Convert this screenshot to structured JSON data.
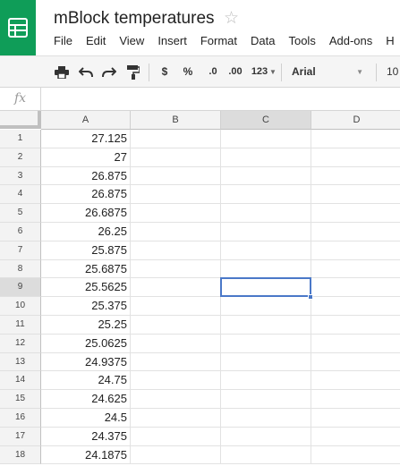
{
  "doc": {
    "title": "mBlock temperatures",
    "star": "☆"
  },
  "menu": [
    "File",
    "Edit",
    "View",
    "Insert",
    "Format",
    "Data",
    "Tools",
    "Add-ons",
    "H"
  ],
  "toolbar": {
    "print_icon": "print-icon",
    "undo_icon": "undo-icon",
    "redo_icon": "redo-icon",
    "paint_icon": "paint-format-icon",
    "currency": "$",
    "percent": "%",
    "decrease_decimal": ".0",
    "increase_decimal": ".00",
    "more_formats": "123",
    "font": "Arial",
    "font_size": "10"
  },
  "formula_bar": {
    "fx": "fx",
    "value": ""
  },
  "grid": {
    "columns": [
      "A",
      "B",
      "C",
      "D"
    ],
    "selected_column": "C",
    "selected_row": "9",
    "rows": [
      {
        "num": "1",
        "a": "27.125"
      },
      {
        "num": "2",
        "a": "27"
      },
      {
        "num": "3",
        "a": "26.875"
      },
      {
        "num": "4",
        "a": "26.875"
      },
      {
        "num": "5",
        "a": "26.6875"
      },
      {
        "num": "6",
        "a": "26.25"
      },
      {
        "num": "7",
        "a": "25.875"
      },
      {
        "num": "8",
        "a": "25.6875"
      },
      {
        "num": "9",
        "a": "25.5625"
      },
      {
        "num": "10",
        "a": "25.375"
      },
      {
        "num": "11",
        "a": "25.25"
      },
      {
        "num": "12",
        "a": "25.0625"
      },
      {
        "num": "13",
        "a": "24.9375"
      },
      {
        "num": "14",
        "a": "24.75"
      },
      {
        "num": "15",
        "a": "24.625"
      },
      {
        "num": "16",
        "a": "24.5"
      },
      {
        "num": "17",
        "a": "24.375"
      },
      {
        "num": "18",
        "a": "24.1875"
      }
    ]
  }
}
